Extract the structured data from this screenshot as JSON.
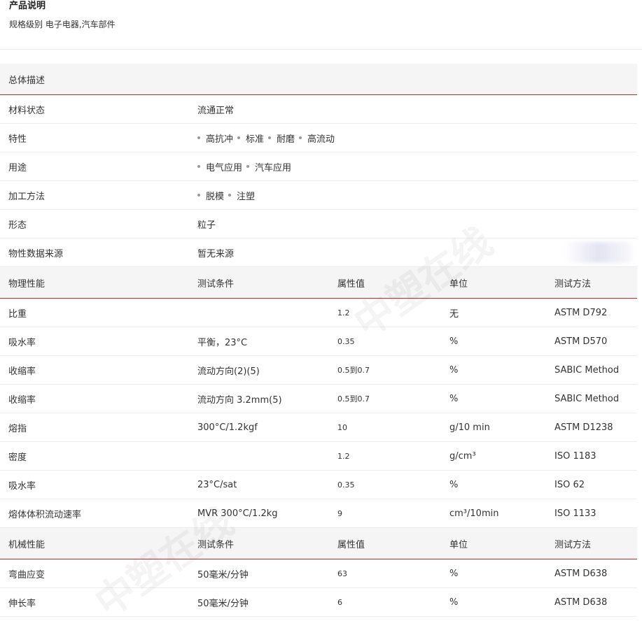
{
  "product": {
    "title": "产品说明",
    "spec_line": "规格级别 电子电器,汽车部件"
  },
  "general": {
    "section_title": "总体描述",
    "rows": [
      {
        "label": "材料状态",
        "value": "流通正常"
      },
      {
        "label": "特性",
        "items": [
          "高抗冲",
          "标准",
          "耐磨",
          "高流动"
        ]
      },
      {
        "label": "用途",
        "items": [
          "电气应用",
          "汽车应用"
        ]
      },
      {
        "label": "加工方法",
        "items": [
          "脱模",
          "注塑"
        ]
      },
      {
        "label": "形态",
        "value": "粒子"
      },
      {
        "label": "物性数据来源",
        "value": "暂无来源"
      }
    ]
  },
  "physical": {
    "headers": [
      "物理性能",
      "测试条件",
      "属性值",
      "单位",
      "测试方法"
    ],
    "rows": [
      [
        "比重",
        "",
        "1.2",
        "无",
        "ASTM D792"
      ],
      [
        "吸水率",
        "平衡，23°C",
        "0.35",
        "%",
        "ASTM D570"
      ],
      [
        "收缩率",
        "流动方向(2)(5)",
        "0.5到0.7",
        "%",
        "SABIC Method"
      ],
      [
        "收缩率",
        "流动方向 3.2mm(5)",
        "0.5到0.7",
        "%",
        "SABIC Method"
      ],
      [
        "熔指",
        "300°C/1.2kgf",
        "10",
        "g/10 min",
        "ASTM D1238"
      ],
      [
        "密度",
        "",
        "1.2",
        "g/cm³",
        "ISO 1183"
      ],
      [
        "吸水率",
        "23°C/sat",
        "0.35",
        "%",
        "ISO 62"
      ],
      [
        "熔体体积流动速率",
        "MVR 300°C/1.2kg",
        "9",
        "cm³/10min",
        "ISO 1133"
      ]
    ]
  },
  "mechanical": {
    "headers": [
      "机械性能",
      "测试条件",
      "属性值",
      "单位",
      "测试方法"
    ],
    "rows": [
      [
        "弯曲应变",
        "50毫米/分钟",
        "63",
        "%",
        "ASTM D638"
      ],
      [
        "伸长率",
        "50毫米/分钟",
        "6",
        "%",
        "ASTM D638"
      ]
    ]
  },
  "colors": {
    "section_bg": "#f5f5f5",
    "accent_line": "#c8282a",
    "row_border": "#ededed"
  }
}
